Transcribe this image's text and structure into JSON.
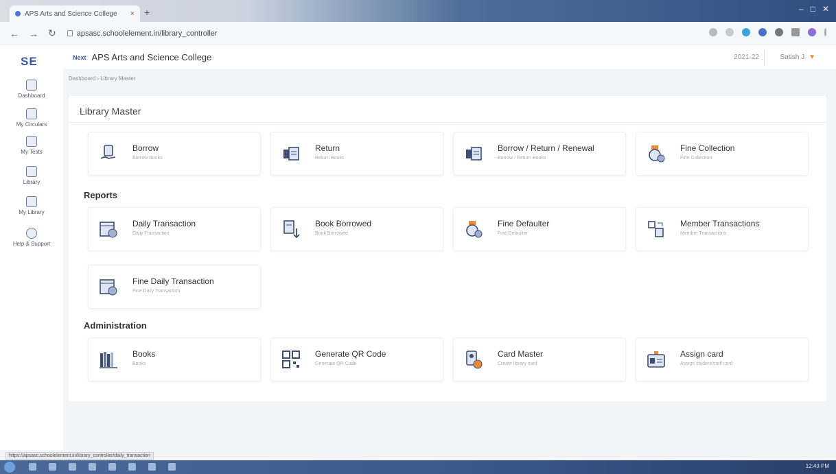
{
  "browser": {
    "tab_title": "APS Arts and Science College",
    "tab_close": "×",
    "new_tab": "+",
    "url": "apsasc.schoolelement.in/library_controller",
    "status_url": "https://apsasc.schoolelement.in/library_controller/daily_transaction"
  },
  "app": {
    "logo": "SE",
    "brand_mark": "Next",
    "college_name": "APS Arts and Science College",
    "academic_year": "2021-22",
    "user_name": "Satish J"
  },
  "sidebar": {
    "items": [
      {
        "label": "Dashboard",
        "icon": "dashboard-icon"
      },
      {
        "label": "My Circulars",
        "icon": "circulars-icon"
      },
      {
        "label": "My Tests",
        "icon": "tests-icon"
      },
      {
        "label": "Library",
        "icon": "library-icon"
      },
      {
        "label": "My Library",
        "icon": "my-library-icon"
      },
      {
        "label": "Help & Support",
        "icon": "help-icon"
      }
    ]
  },
  "breadcrumb": "Dashboard › Library Master",
  "page_title": "Library Master",
  "library_master": [
    {
      "title": "Borrow",
      "subtitle": "Borrow Books",
      "icon": "borrow-icon"
    },
    {
      "title": "Return",
      "subtitle": "Return Books",
      "icon": "return-icon"
    },
    {
      "title": "Borrow / Return / Renewal",
      "subtitle": "Borrow / Return Books",
      "icon": "renewal-icon"
    },
    {
      "title": "Fine Collection",
      "subtitle": "Fine Collection",
      "icon": "fine-collection-icon"
    }
  ],
  "reports_title": "Reports",
  "reports": [
    {
      "title": "Daily Transaction",
      "subtitle": "Daily Transaction",
      "icon": "daily-transaction-icon"
    },
    {
      "title": "Book Borrowed",
      "subtitle": "Book Borrowed",
      "icon": "book-borrowed-icon"
    },
    {
      "title": "Fine Defaulter",
      "subtitle": "Fine Defaulter",
      "icon": "fine-defaulter-icon"
    },
    {
      "title": "Member Transactions",
      "subtitle": "Member Transactions",
      "icon": "member-transactions-icon"
    },
    {
      "title": "Fine Daily Transaction",
      "subtitle": "Fine Daily Transaction",
      "icon": "fine-daily-icon"
    }
  ],
  "administration_title": "Administration",
  "administration": [
    {
      "title": "Books",
      "subtitle": "Books",
      "icon": "books-icon"
    },
    {
      "title": "Generate QR Code",
      "subtitle": "Generate QR Code",
      "icon": "qr-code-icon"
    },
    {
      "title": "Card Master",
      "subtitle": "Create library card",
      "icon": "card-master-icon"
    },
    {
      "title": "Assign card",
      "subtitle": "Assign student/staff card",
      "icon": "assign-card-icon"
    }
  ],
  "taskbar": {
    "clock": "12:43 PM"
  },
  "colors": {
    "accent": "#3b57a8",
    "user_caret": "#e8923d",
    "card_border": "#eef0f4"
  }
}
